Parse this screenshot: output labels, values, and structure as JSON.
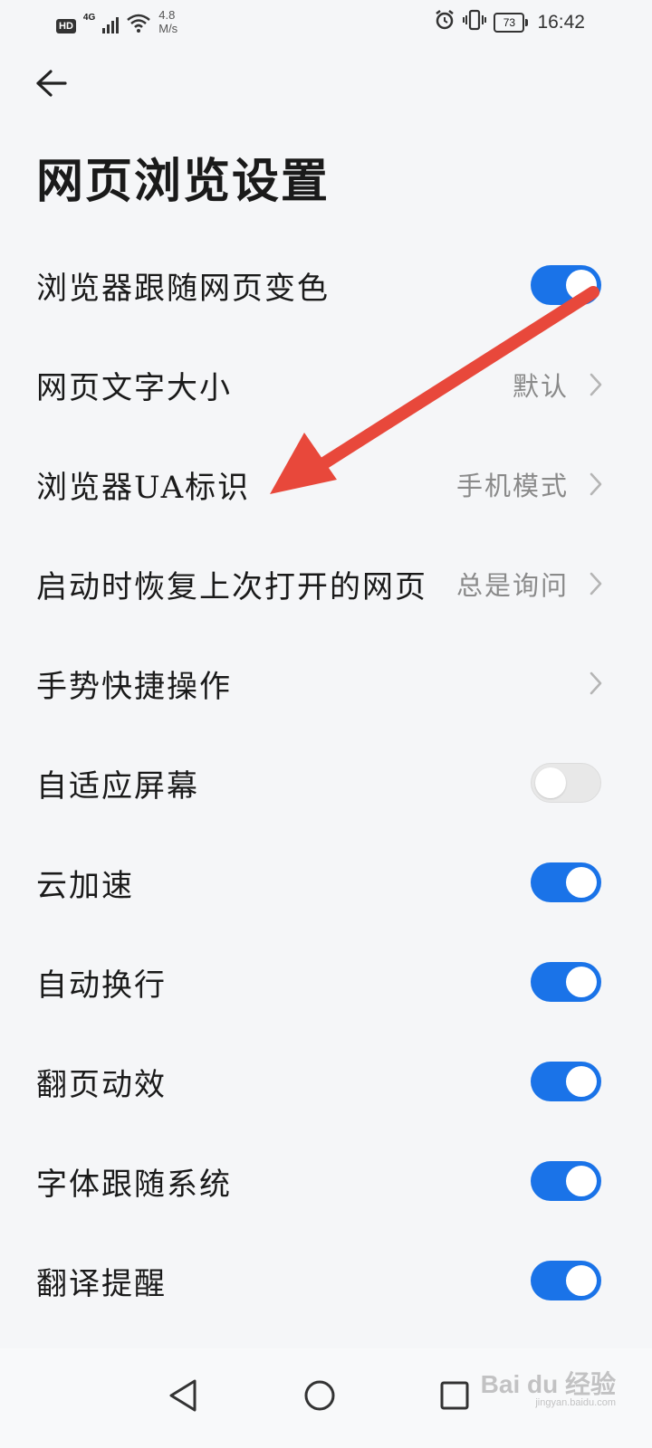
{
  "status_bar": {
    "hd_label": "HD",
    "network_type": "4G",
    "speed_value": "4.8",
    "speed_unit": "M/s",
    "battery_level": "73",
    "time": "16:42",
    "icons": [
      "signal-icon",
      "wifi-icon",
      "alarm-icon",
      "vibrate-icon",
      "battery-icon"
    ]
  },
  "header": {
    "title": "网页浏览设置",
    "back_icon": "back-arrow-icon"
  },
  "settings": [
    {
      "label": "浏览器跟随网页变色",
      "control": "toggle",
      "on": true
    },
    {
      "label": "网页文字大小",
      "control": "chevron",
      "value": "默认"
    },
    {
      "label": "浏览器UA标识",
      "control": "chevron",
      "value": "手机模式"
    },
    {
      "label": "启动时恢复上次打开的网页",
      "control": "chevron",
      "value": "总是询问"
    },
    {
      "label": "手势快捷操作",
      "control": "chevron",
      "value": ""
    },
    {
      "label": "自适应屏幕",
      "control": "toggle",
      "on": false
    },
    {
      "label": "云加速",
      "control": "toggle",
      "on": true
    },
    {
      "label": "自动换行",
      "control": "toggle",
      "on": true
    },
    {
      "label": "翻页动效",
      "control": "toggle",
      "on": true
    },
    {
      "label": "字体跟随系统",
      "control": "toggle",
      "on": true
    },
    {
      "label": "翻译提醒",
      "control": "toggle",
      "on": true
    }
  ],
  "annotation": {
    "color": "#e8483b",
    "icon": "red-arrow-annotation"
  },
  "nav_bar": {
    "icons": [
      "back-triangle-icon",
      "home-circle-icon",
      "recents-square-icon"
    ]
  },
  "watermark": {
    "text": "Bai du 经验",
    "sub": "jingyan.baidu.com"
  },
  "colors": {
    "accent": "#1a73e8",
    "toggle_off": "#e8e8e8",
    "secondary_text": "#8a8a8a"
  }
}
